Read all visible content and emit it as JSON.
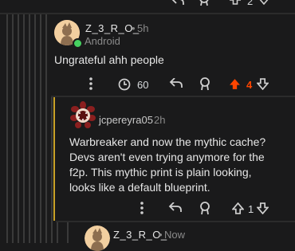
{
  "top_actions": {
    "upvote_count": "2"
  },
  "comment1": {
    "username": "Z_3_R_O_",
    "dot": "•",
    "time": "5h",
    "flair": "Android",
    "body": "Ungrateful ahh people",
    "award_count": "60",
    "vote_count": "4",
    "upvote_color": "#ff4500"
  },
  "comment2": {
    "username": "jcpereyra05",
    "time": "2h",
    "body_lines": [
      "Warbreaker and now the mythic cache?",
      "Devs aren't even trying anymore for the",
      "f2p. This mythic print is plain looking,",
      "looks like a default blueprint."
    ],
    "vote_count": "1"
  },
  "comment3": {
    "username": "Z_3_R_O_",
    "dot": "•",
    "time": "Now"
  }
}
